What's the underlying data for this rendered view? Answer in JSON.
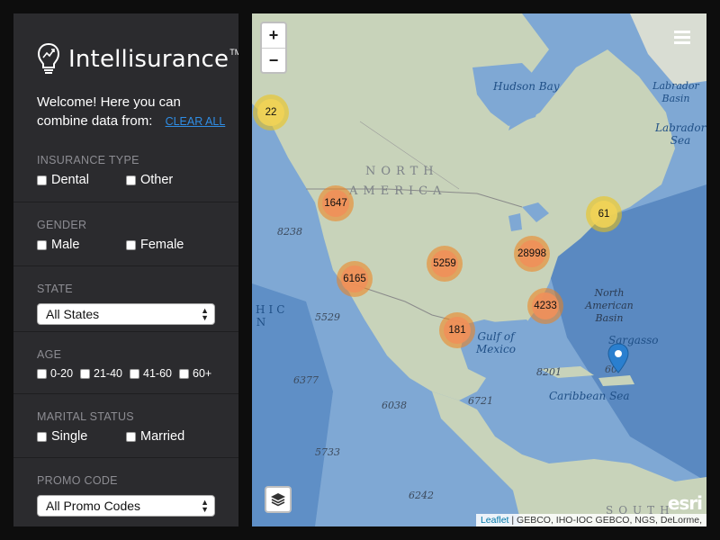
{
  "brand": {
    "name": "Intellisurance",
    "tm": "TM"
  },
  "welcome": {
    "text": "Welcome! Here you can combine data from:",
    "clear_all": "CLEAR ALL"
  },
  "filters": {
    "insurance_type": {
      "title": "INSURANCE TYPE",
      "options": [
        "Dental",
        "Other"
      ]
    },
    "gender": {
      "title": "GENDER",
      "options": [
        "Male",
        "Female"
      ]
    },
    "state": {
      "title": "STATE",
      "selected": "All States"
    },
    "age": {
      "title": "AGE",
      "options": [
        "0-20",
        "21-40",
        "41-60",
        "60+"
      ]
    },
    "marital_status": {
      "title": "MARITAL STATUS",
      "options": [
        "Single",
        "Married"
      ]
    },
    "promo_code": {
      "title": "PROMO CODE",
      "selected": "All Promo Codes"
    }
  },
  "map": {
    "zoom_in": "+",
    "zoom_out": "−",
    "clusters": [
      {
        "count": "22",
        "color": "yellow"
      },
      {
        "count": "1647",
        "color": "orange"
      },
      {
        "count": "61",
        "color": "yellow"
      },
      {
        "count": "5259",
        "color": "orange"
      },
      {
        "count": "28998",
        "color": "orange"
      },
      {
        "count": "6165",
        "color": "orange"
      },
      {
        "count": "4233",
        "color": "orange"
      },
      {
        "count": "181",
        "color": "orange"
      }
    ],
    "labels": {
      "hudson_bay": "Hudson Bay",
      "labrador_basin": "Labrador Basin",
      "labrador_sea": "Labrador Sea",
      "north": "NORTH",
      "america": "AMERICA",
      "north_american_basin": "North American Basin",
      "gulf_of_mexico": "Gulf of Mexico",
      "sargasso": "Sargasso",
      "caribbean_sea": "Caribbean Sea",
      "south": "SOUTH",
      "pacific_fragment": "HIC N"
    },
    "depths": [
      "8238",
      "5529",
      "6377",
      "6038",
      "6721",
      "8201",
      "5733",
      "6242",
      "60"
    ],
    "attribution": {
      "leaflet": "Leaflet",
      "rest": "| GEBCO, IHO-IOC GEBCO, NGS, DeLorme,"
    },
    "esri": "esri"
  },
  "colors": {
    "sidebar_bg": "#2b2b2e",
    "accent_link": "#2f8de4",
    "cluster_orange": "#f0905a",
    "cluster_yellow": "#f1d357"
  }
}
